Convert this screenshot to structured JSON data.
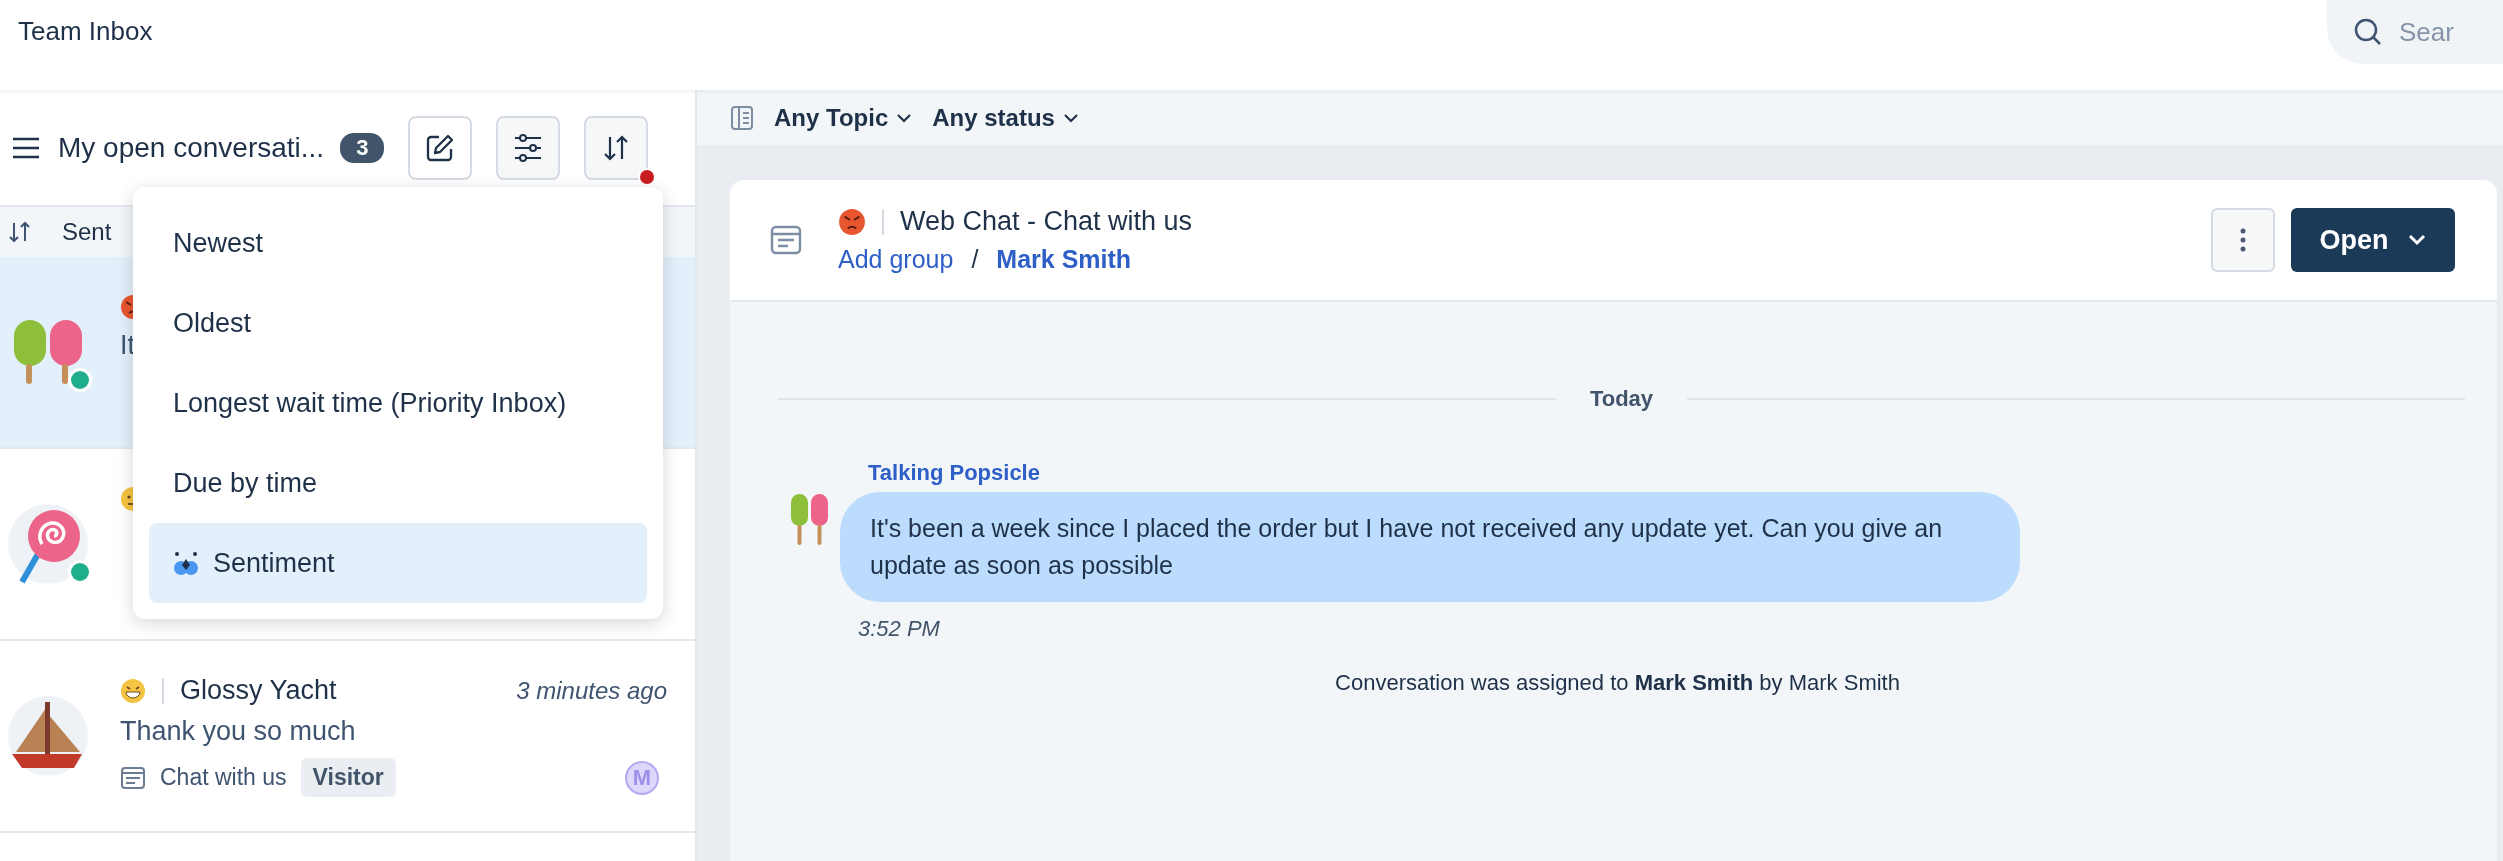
{
  "header": {
    "title": "Team Inbox",
    "search": {
      "placeholder": "Sear"
    }
  },
  "sidebar": {
    "title": "My open conversati...",
    "count": "3",
    "sort_indicator": true,
    "sort_label": "Sent",
    "conversations": [
      {
        "avatar": {
          "kind": "popsicle"
        },
        "sentiment": {
          "kind": "angry"
        },
        "online": true,
        "selected": true,
        "preview": "It"
      },
      {
        "avatar": {
          "kind": "lollipop"
        },
        "sentiment": {
          "kind": "neutral"
        },
        "online": true,
        "selected": false
      },
      {
        "avatar": {
          "kind": "sailboat"
        },
        "sentiment": {
          "kind": "happy"
        },
        "online": false,
        "selected": false,
        "name": "Glossy Yacht",
        "time": "3 minutes ago",
        "preview": "Thank you so much",
        "channel": "Chat with us",
        "tag": "Visitor",
        "assignee": "M"
      }
    ]
  },
  "sort_menu": {
    "items": [
      {
        "label": "Newest",
        "selected": false,
        "kind": "plain"
      },
      {
        "label": "Oldest",
        "selected": false,
        "kind": "plain"
      },
      {
        "label": "Longest wait time (Priority Inbox)",
        "selected": false,
        "kind": "plain"
      },
      {
        "label": "Due by time",
        "selected": false,
        "kind": "plain"
      },
      {
        "label": "Sentiment",
        "selected": true,
        "kind": "ai"
      }
    ]
  },
  "filters": [
    "Any Topic",
    "Any status"
  ],
  "conversation": {
    "sentiment": {
      "kind": "angry"
    },
    "title": "Web Chat - Chat with us",
    "group": "Add group",
    "separator": "/",
    "assignee": "Mark Smith",
    "status": "Open",
    "date": "Today",
    "message": {
      "sender": "Talking Popsicle",
      "text": "It's been a week since I placed the order but I have not received any update yet. Can you give an update as soon as possible",
      "time": "3:52 PM"
    },
    "event": "Conversation was assigned to **Mark Smith** by Mark Smith"
  }
}
